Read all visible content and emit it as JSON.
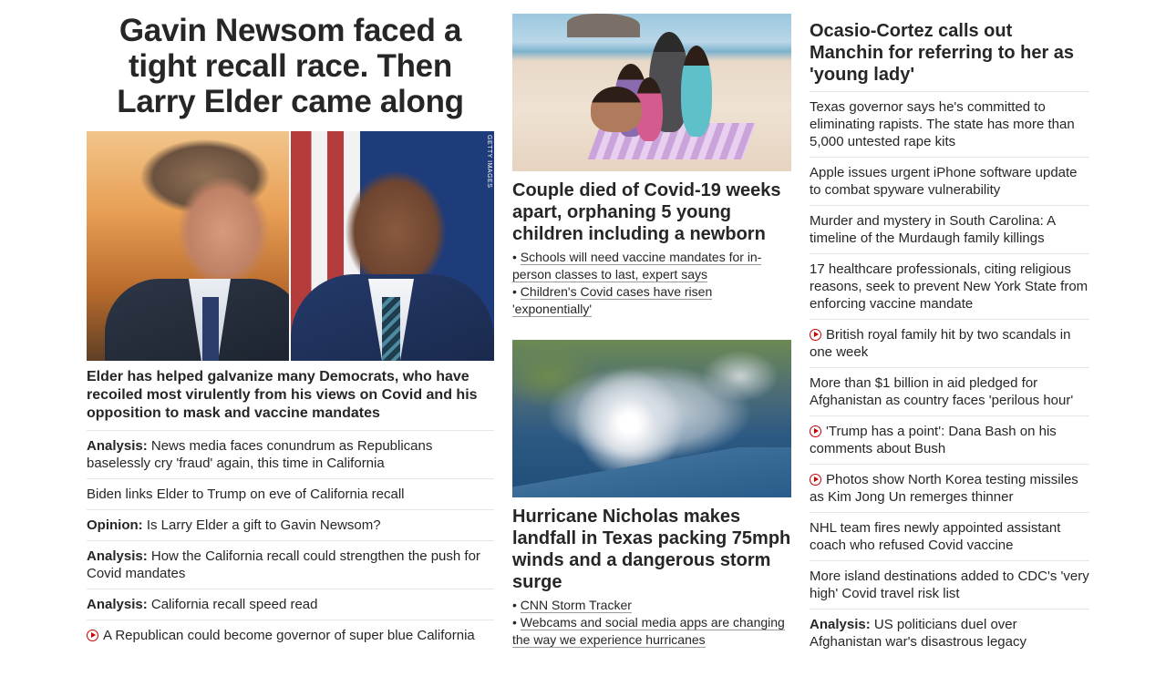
{
  "left": {
    "headline": "Gavin Newsom faced a tight recall race. Then Larry Elder came along",
    "image_credit": "GETTY IMAGES",
    "subheadline": "Elder has helped galvanize many Democrats, who have recoiled most virulently from his views on Covid and his opposition to mask and vaccine mandates",
    "items": [
      {
        "kicker": "Analysis:",
        "text": "News media faces conundrum as Republicans baselessly cry 'fraud' again, this time in California"
      },
      {
        "kicker": "",
        "text": "Biden links Elder to Trump on eve of California recall"
      },
      {
        "kicker": "Opinion:",
        "text": "Is Larry Elder a gift to Gavin Newsom?"
      },
      {
        "kicker": "Analysis:",
        "text": "How the California recall could strengthen the push for Covid mandates"
      },
      {
        "kicker": "Analysis:",
        "text": "California recall speed read"
      },
      {
        "kicker": "",
        "text": "A Republican could become governor of super blue California",
        "icon": "play-video-icon"
      }
    ]
  },
  "middle": {
    "story1": {
      "headline": "Couple died of Covid-19 weeks apart, orphaning 5 young children including a newborn",
      "bullets": [
        "Schools will need vaccine mandates for in-person classes to last, expert says",
        "Children's Covid cases have risen 'exponentially'"
      ]
    },
    "story2": {
      "headline": "Hurricane Nicholas makes landfall in Texas packing 75mph winds and a dangerous storm surge",
      "bullets": [
        "CNN Storm Tracker",
        "Webcams and social media apps are changing the way we experience hurricanes"
      ]
    }
  },
  "right": {
    "headline": "Ocasio-Cortez calls out Manchin for referring to her as 'young lady'",
    "items": [
      {
        "kicker": "",
        "text": "Texas governor says he's committed to eliminating rapists. The state has more than 5,000 untested rape kits"
      },
      {
        "kicker": "",
        "text": "Apple issues urgent iPhone software update to combat spyware vulnerability"
      },
      {
        "kicker": "",
        "text": "Murder and mystery in South Carolina: A timeline of the Murdaugh family killings"
      },
      {
        "kicker": "",
        "text": "17 healthcare professionals, citing religious reasons, seek to prevent New York State from enforcing vaccine mandate"
      },
      {
        "kicker": "",
        "text": "British royal family hit by two scandals in one week",
        "icon": "play-video-icon"
      },
      {
        "kicker": "",
        "text": "More than $1 billion in aid pledged for Afghanistan as country faces 'perilous hour'"
      },
      {
        "kicker": "",
        "text": "'Trump has a point': Dana Bash on his comments about Bush",
        "icon": "play-video-icon"
      },
      {
        "kicker": "",
        "text": "Photos show North Korea testing missiles as Kim Jong Un remerges thinner",
        "icon": "play-video-icon"
      },
      {
        "kicker": "",
        "text": "NHL team fires newly appointed assistant coach who refused Covid vaccine"
      },
      {
        "kicker": "",
        "text": "More island destinations added to CDC's 'very high' Covid travel risk list"
      },
      {
        "kicker": "Analysis:",
        "text": "US politicians duel over Afghanistan war's disastrous legacy"
      }
    ]
  },
  "colors": {
    "text": "#262626",
    "divider": "#e6e6e6",
    "play_icon": "#cc0000"
  }
}
